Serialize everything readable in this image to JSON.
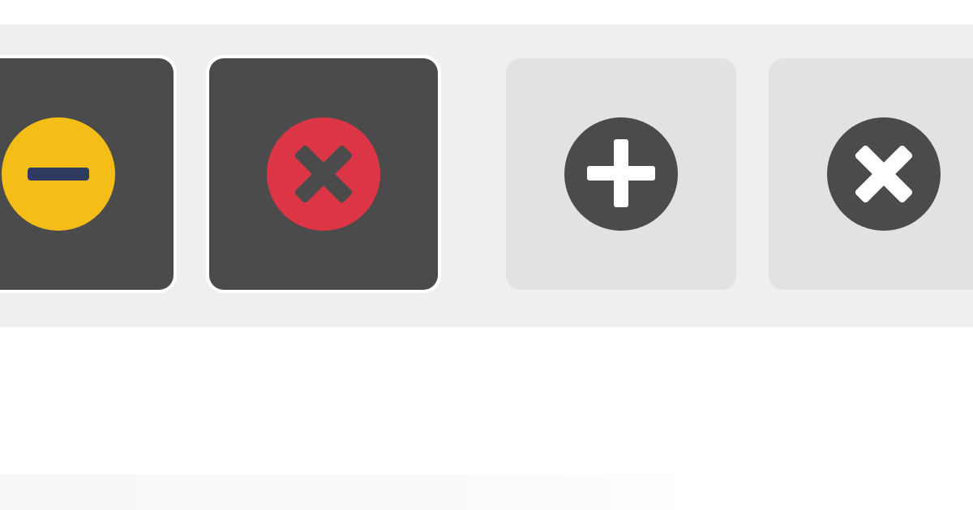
{
  "toolbar": {
    "buttons": [
      {
        "name": "minus",
        "icon": "minus-circle-icon",
        "state": "active",
        "icon_color": "#f5bd18",
        "glyph_color": "#2e3b5e"
      },
      {
        "name": "close",
        "icon": "close-circle-icon",
        "state": "active",
        "icon_color": "#dc3545",
        "glyph_color": "#4b4b4b"
      },
      {
        "name": "add",
        "icon": "plus-circle-icon",
        "state": "inactive",
        "icon_color": "#4b4b4b",
        "glyph_color": "#ffffff"
      },
      {
        "name": "close",
        "icon": "close-circle-icon",
        "state": "inactive",
        "icon_color": "#4b4b4b",
        "glyph_color": "#ffffff"
      }
    ]
  },
  "colors": {
    "active_tile": "#4b4b4b",
    "inactive_tile": "#e2e2e2",
    "strip_background": "#efefef"
  }
}
